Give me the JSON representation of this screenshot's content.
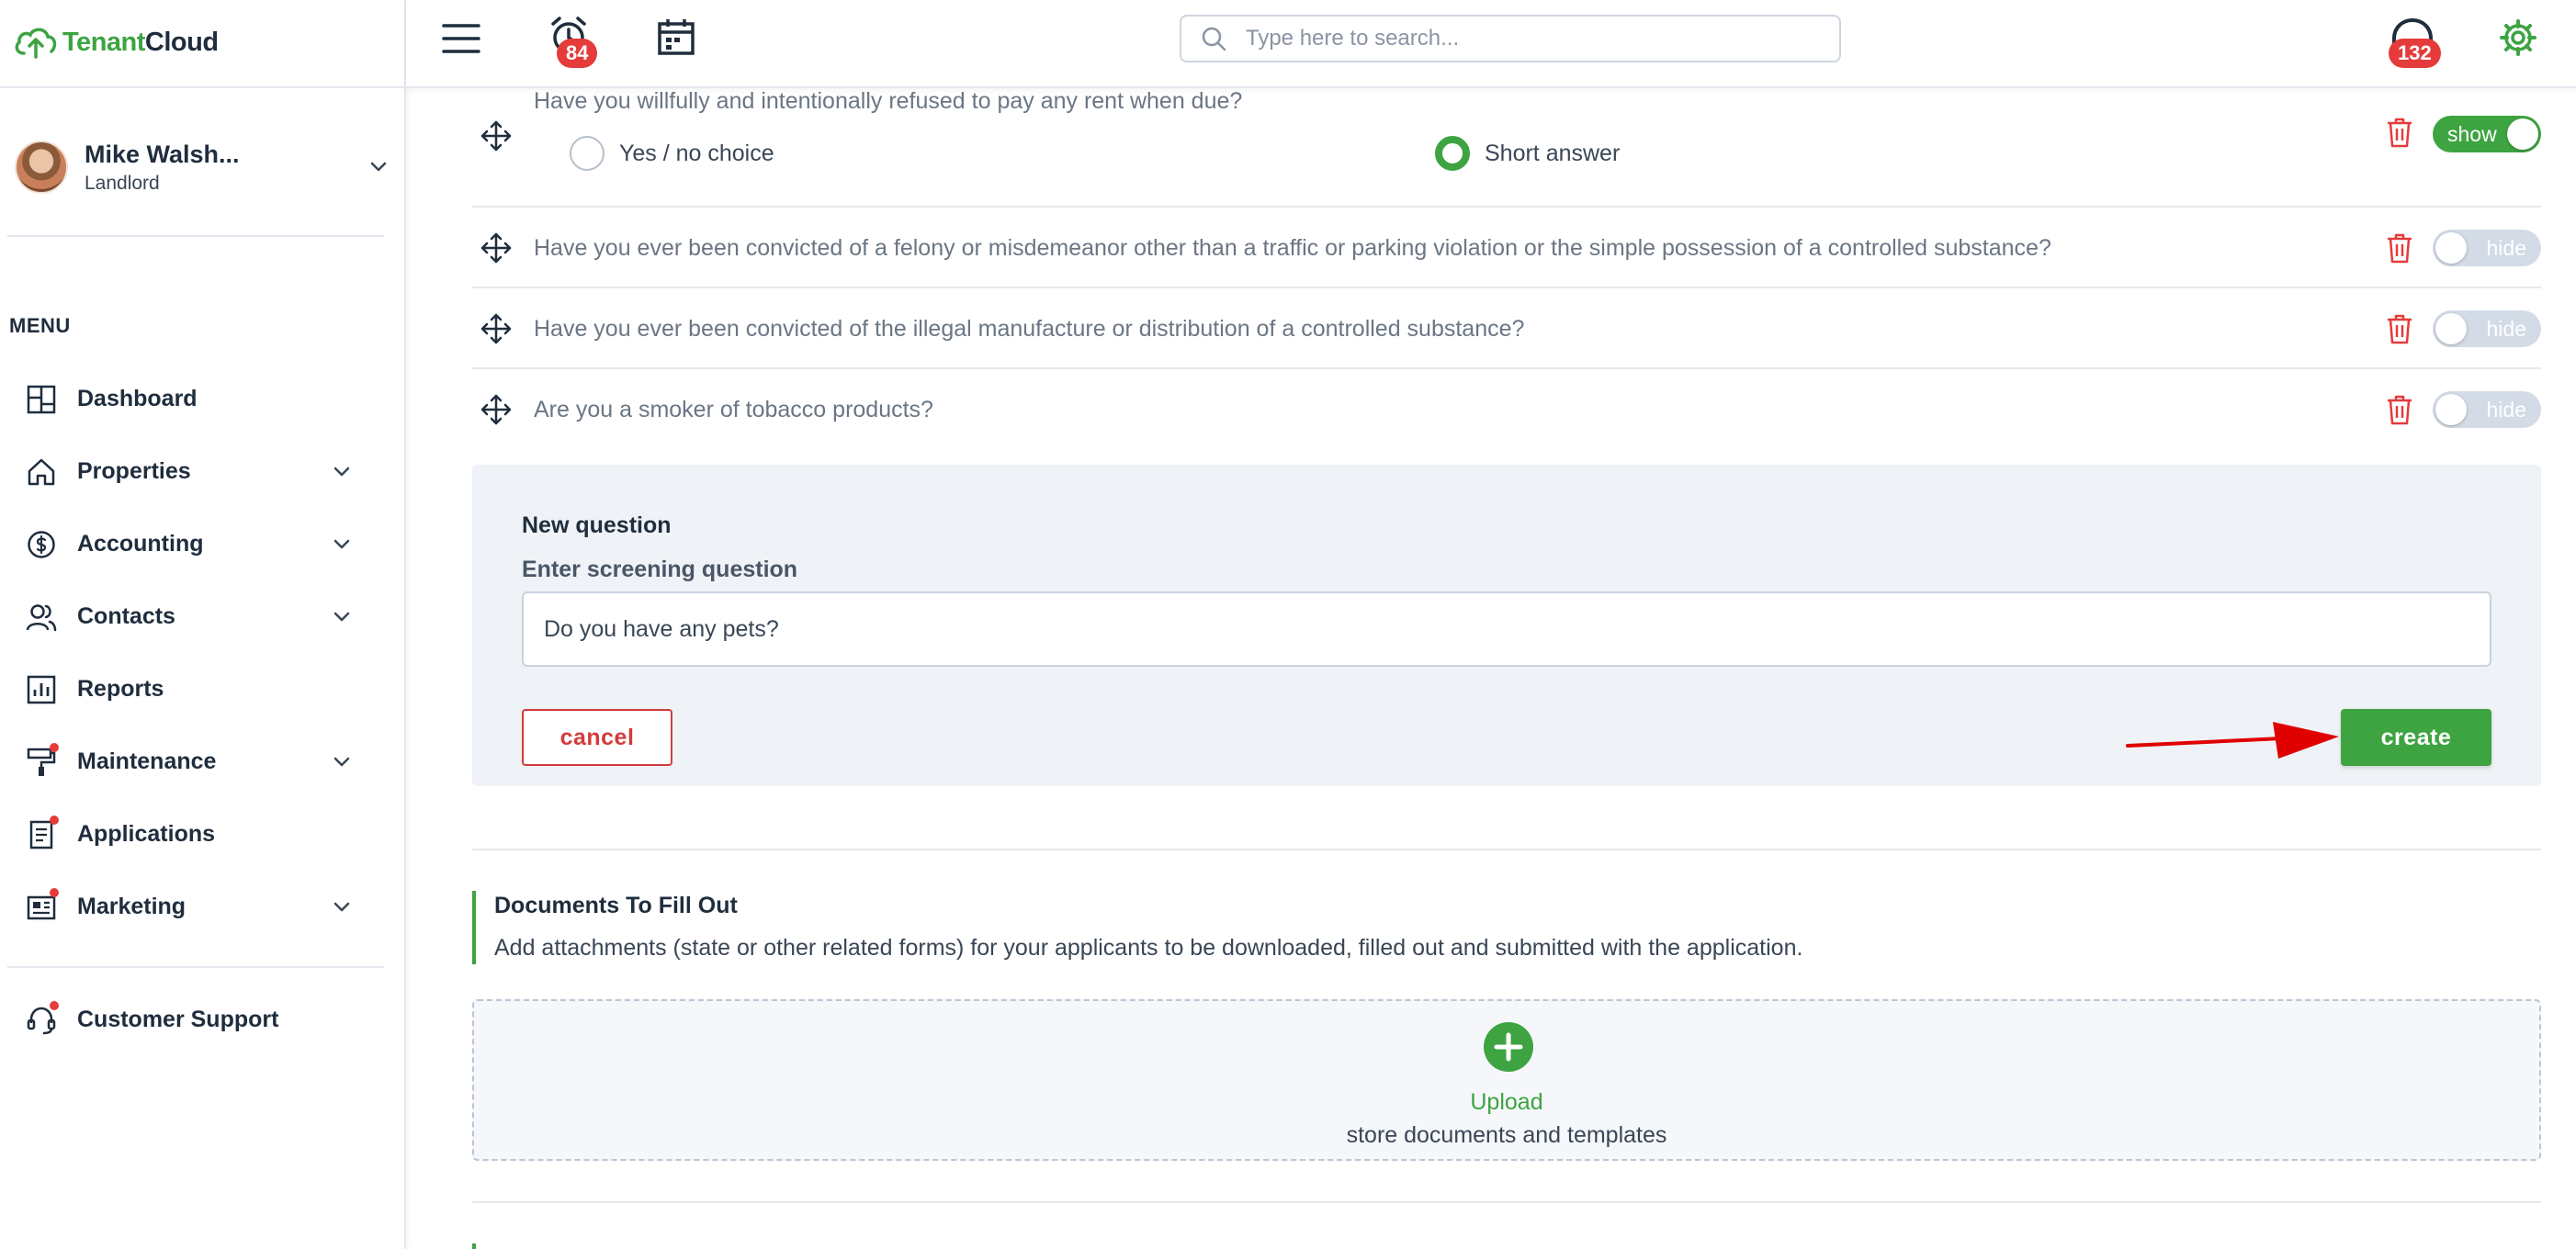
{
  "app": {
    "logo_prefix": "Tenant",
    "logo_suffix": "Cloud",
    "brand_color": "#3da441",
    "danger_color": "#e53b3b"
  },
  "user": {
    "name": "Mike Walsh...",
    "role": "Landlord"
  },
  "menu": {
    "title": "MENU",
    "items": [
      {
        "label": "Dashboard",
        "icon": "dashboard-icon",
        "has_chevron": false,
        "has_dot": false
      },
      {
        "label": "Properties",
        "icon": "home-icon",
        "has_chevron": true,
        "has_dot": false
      },
      {
        "label": "Accounting",
        "icon": "dollar-icon",
        "has_chevron": true,
        "has_dot": false
      },
      {
        "label": "Contacts",
        "icon": "contacts-icon",
        "has_chevron": true,
        "has_dot": false
      },
      {
        "label": "Reports",
        "icon": "reports-icon",
        "has_chevron": false,
        "has_dot": false
      },
      {
        "label": "Maintenance",
        "icon": "paint-roller-icon",
        "has_chevron": true,
        "has_dot": true
      },
      {
        "label": "Applications",
        "icon": "document-icon",
        "has_chevron": false,
        "has_dot": true
      },
      {
        "label": "Marketing",
        "icon": "newspaper-icon",
        "has_chevron": true,
        "has_dot": true
      }
    ],
    "support_label": "Customer Support"
  },
  "header": {
    "alarm_count": "84",
    "search_placeholder": "Type here to search...",
    "support_count": "132"
  },
  "questions": [
    {
      "text": "Have you willfully and intentionally refused to pay any rent when due?",
      "toggle": "show",
      "state": "on",
      "options": [
        {
          "label": "Yes / no choice",
          "selected": false
        },
        {
          "label": "Short answer",
          "selected": true
        }
      ]
    },
    {
      "text": "Have you ever been convicted of a felony or misdemeanor other than a traffic or parking violation or the simple possession of a controlled substance?",
      "toggle": "hide",
      "state": "off"
    },
    {
      "text": "Have you ever been convicted of the illegal manufacture or distribution of a controlled substance?",
      "toggle": "hide",
      "state": "off"
    },
    {
      "text": "Are you a smoker of tobacco products?",
      "toggle": "hide",
      "state": "off"
    }
  ],
  "new_question": {
    "title": "New question",
    "label": "Enter screening question",
    "value": "Do you have any pets?",
    "cancel_label": "cancel",
    "create_label": "create"
  },
  "documents": {
    "title": "Documents To Fill Out",
    "description": "Add attachments (state or other related forms) for your applicants to be downloaded, filled out and submitted with the application.",
    "upload_label": "Upload",
    "upload_sub": "store documents and templates"
  }
}
